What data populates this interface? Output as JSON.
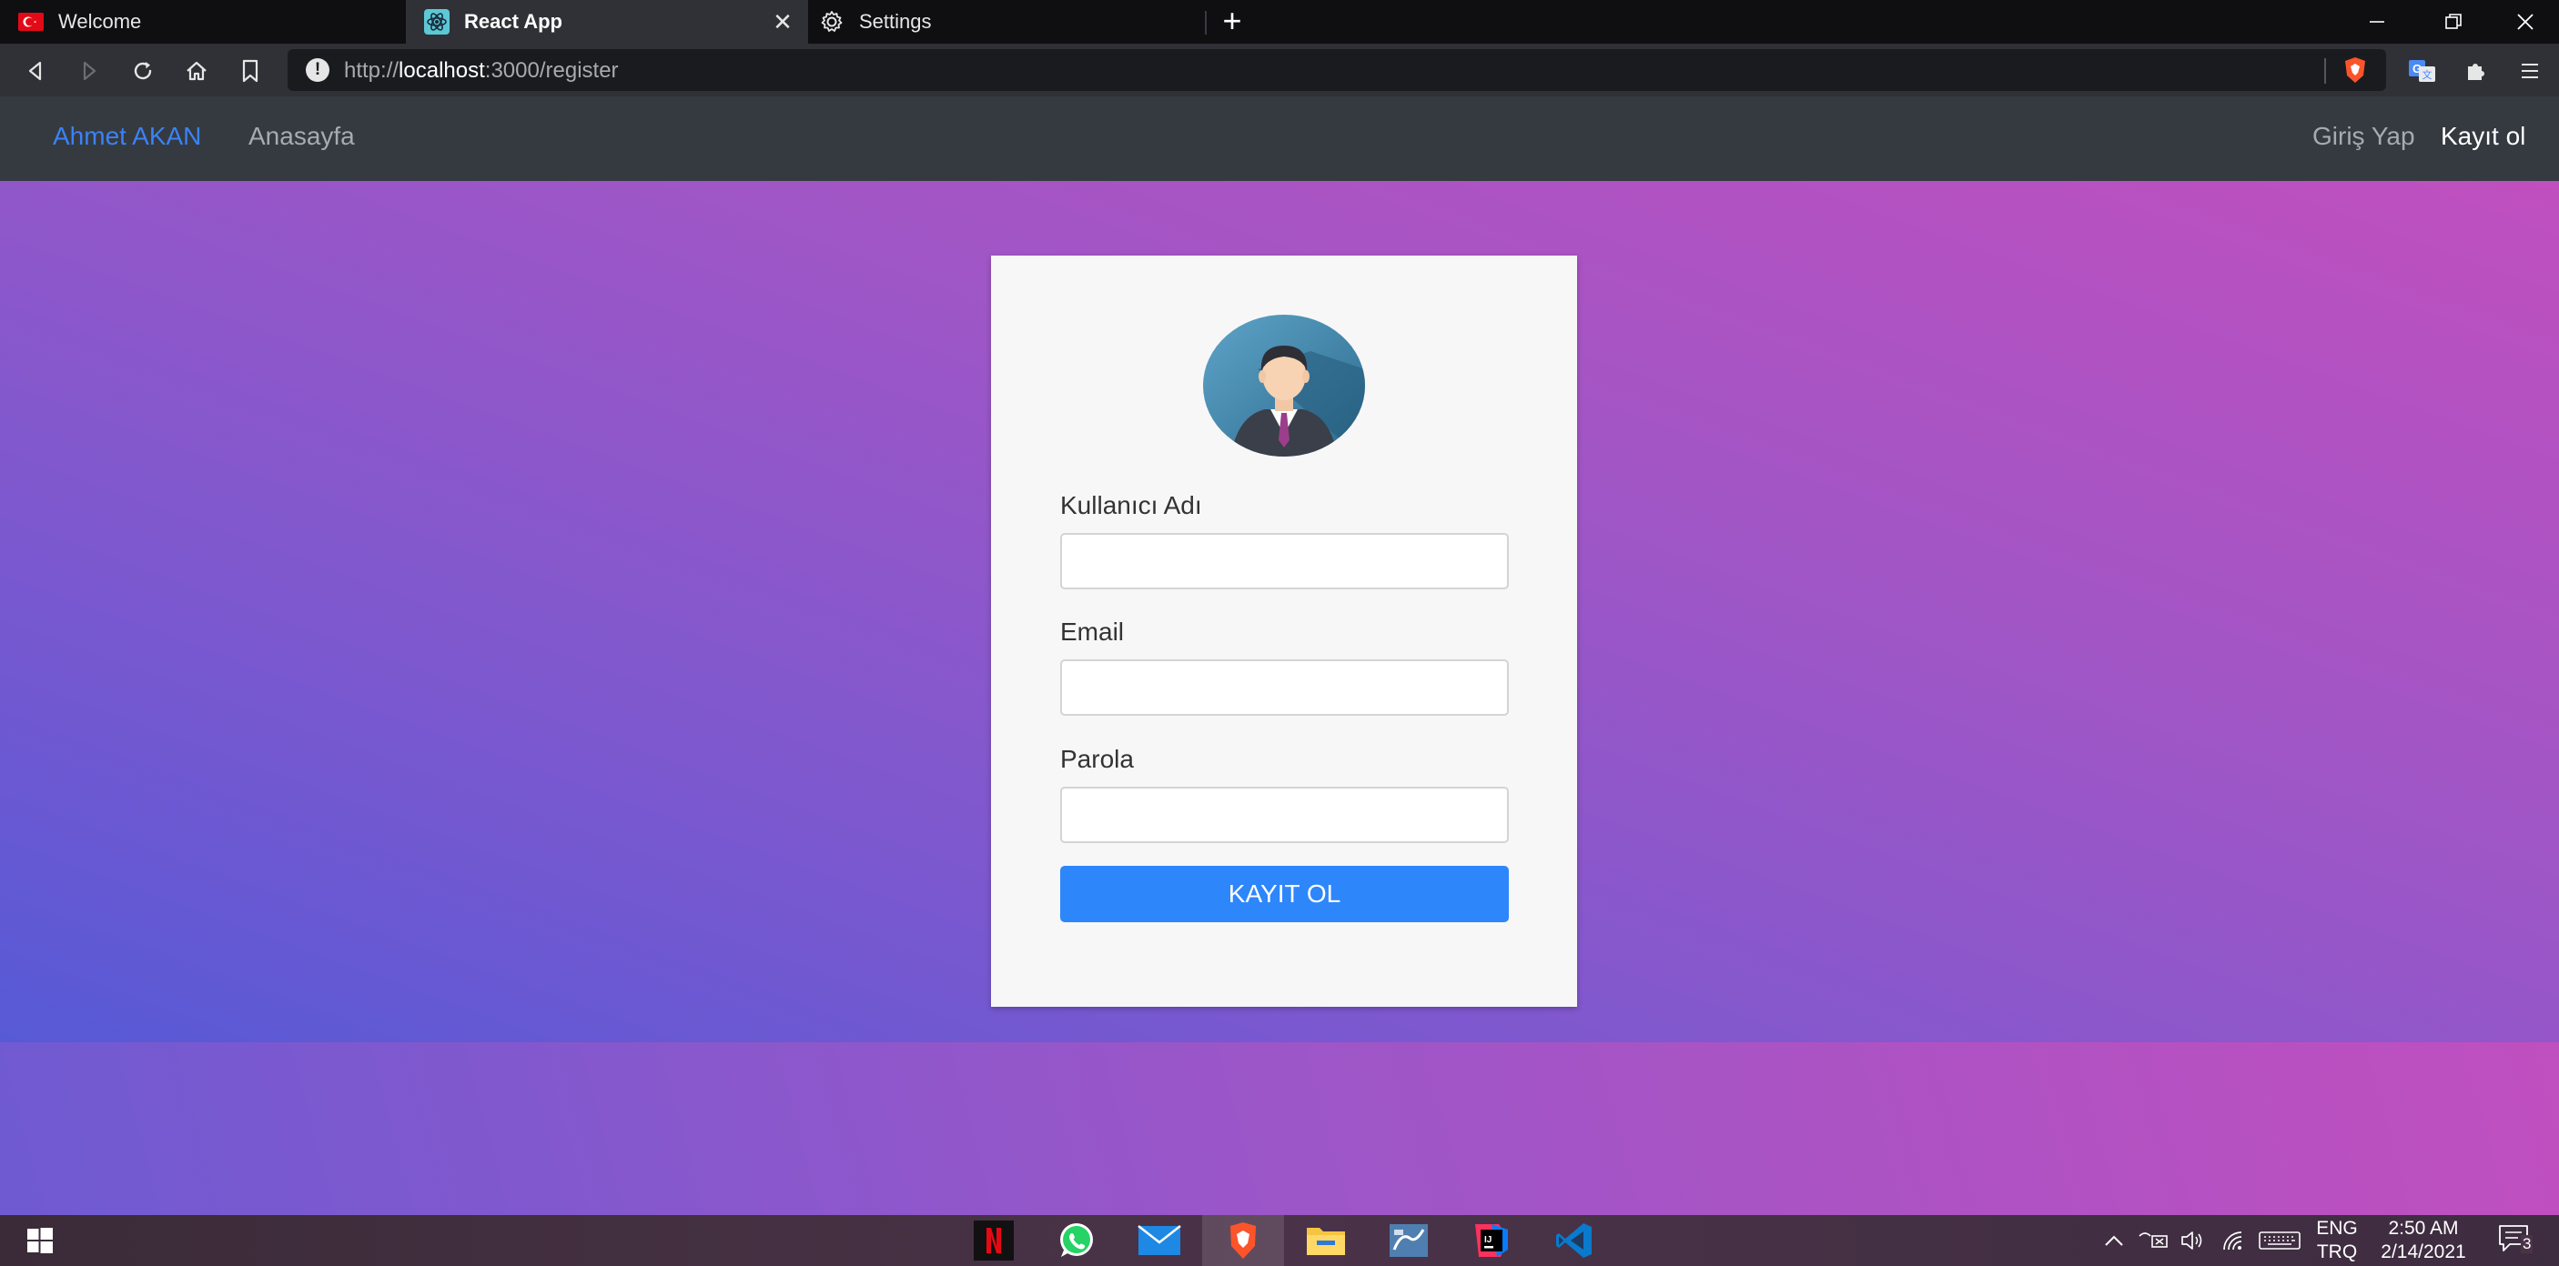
{
  "browser": {
    "tabs": [
      {
        "title": "Welcome",
        "icon": "turkey-flag-icon",
        "active": false
      },
      {
        "title": "React App",
        "icon": "react-icon",
        "active": true
      },
      {
        "title": "Settings",
        "icon": "gear-icon",
        "active": false
      }
    ],
    "new_tab_label": "+",
    "url_prefix": "http://",
    "url_host": "localhost",
    "url_path": ":3000/register",
    "info_badge": "!"
  },
  "app_nav": {
    "brand": "Ahmet AKAN",
    "home_link": "Anasayfa",
    "login_link": "Giriş Yap",
    "register_link": "Kayıt ol",
    "brand_color": "#3b82f6"
  },
  "form": {
    "username_label": "Kullanıcı Adı",
    "username_value": "",
    "email_label": "Email",
    "email_value": "",
    "password_label": "Parola",
    "password_value": "",
    "submit_label": "KAYIT OL",
    "submit_color": "#2e86fb"
  },
  "taskbar": {
    "apps": [
      "netflix-icon",
      "whatsapp-icon",
      "mail-icon",
      "brave-icon",
      "file-explorer-icon",
      "mysql-workbench-icon",
      "intellij-icon",
      "vscode-icon"
    ],
    "lang_primary": "ENG",
    "lang_secondary": "TRQ",
    "time": "2:50 AM",
    "date": "2/14/2021",
    "notification_count": "3"
  }
}
